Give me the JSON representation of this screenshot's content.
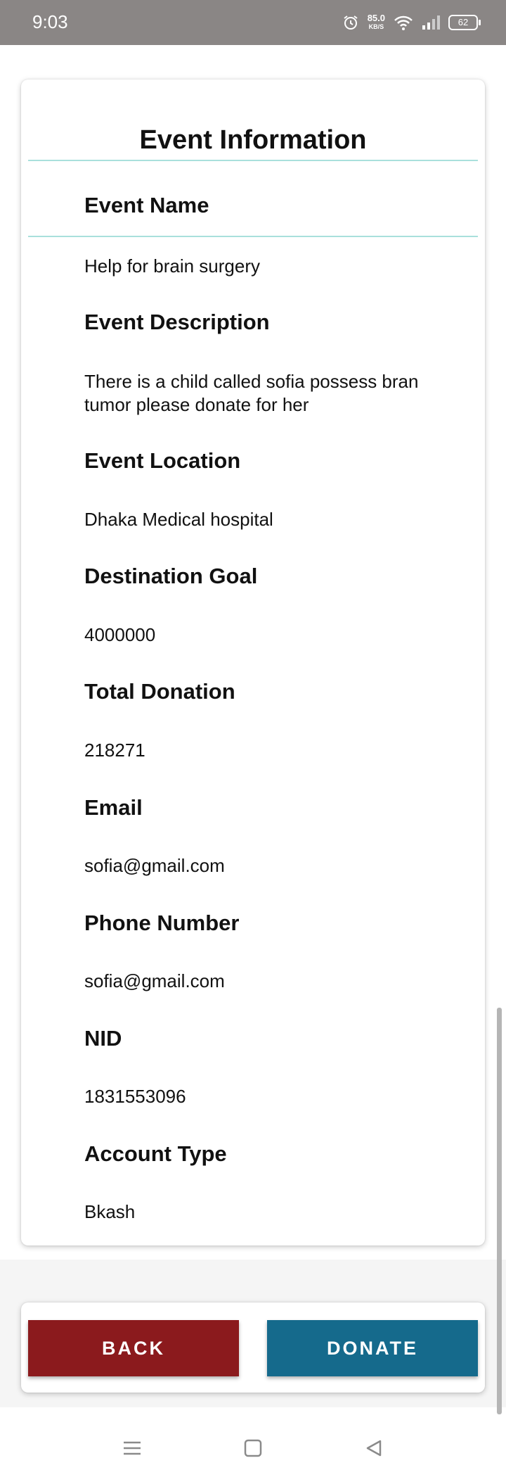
{
  "status_bar": {
    "time": "9:03",
    "net_speed_value": "85.0",
    "net_speed_unit": "KB/S",
    "battery": "62"
  },
  "card": {
    "title": "Event Information",
    "fields": [
      {
        "label": "Event Name",
        "value": "Help for brain surgery"
      },
      {
        "label": "Event Description",
        "value": "There is a child called sofia possess bran tumor please donate for her"
      },
      {
        "label": "Event Location",
        "value": "Dhaka Medical hospital"
      },
      {
        "label": "Destination Goal",
        "value": "4000000"
      },
      {
        "label": "Total Donation",
        "value": "218271"
      },
      {
        "label": "Email",
        "value": "sofia@gmail.com"
      },
      {
        "label": "Phone Number",
        "value": "sofia@gmail.com"
      },
      {
        "label": "NID",
        "value": "1831553096"
      },
      {
        "label": "Account Type",
        "value": "Bkash"
      }
    ]
  },
  "buttons": {
    "back_label": "BACK",
    "donate_label": "DONATE"
  },
  "colors": {
    "status_bar": "#8a8685",
    "back_button": "#8b1a1d",
    "donate_button": "#156a8c",
    "divider": "#a9e0dc"
  },
  "icons": {
    "status": [
      "alarm-icon",
      "wifi-icon",
      "signal-icon",
      "battery-icon"
    ],
    "nav": [
      "menu-icon",
      "home-icon",
      "back-triangle-icon"
    ]
  }
}
